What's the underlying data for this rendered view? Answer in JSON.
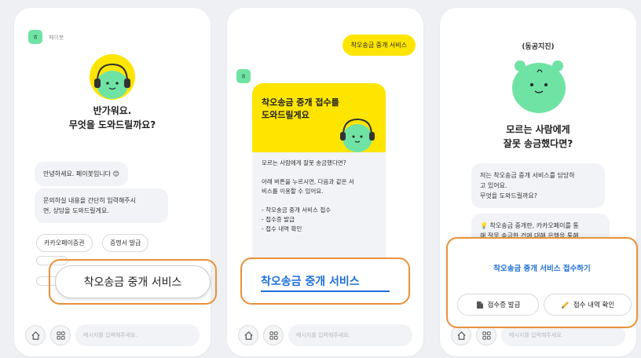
{
  "screen1": {
    "bot_name": "페이봇",
    "greeting_line1": "반가워요.",
    "greeting_line2": "무엇을 도와드릴까요?",
    "bubble_hello": "안녕하세요. 페이봇입니다 😊",
    "bubble_help_line1": "문의하실 내용을 간단히 입력해주시",
    "bubble_help_line2": "면, 상담을 도와드릴게요.",
    "chips": [
      "카카오페이증권",
      "증명서 발급"
    ],
    "highlight_button": "착오송금 중개 서비스",
    "input_placeholder": "메시지를 입력해주세요."
  },
  "screen2": {
    "user_message": "착오송금 중개 서비스",
    "card_title_line1": "착오송금 중개 접수를",
    "card_title_line2": "도와드릴게요",
    "card_lines": [
      "모르는 사람에게 잘못 송금했다면?",
      "",
      "아래 버튼을 누르시면, 다음과 같은 서",
      "비스를 이용할 수 있어요.",
      "",
      "- 착오송금 중개 서비스 접수",
      "- 접수증 발급",
      "- 접수 내역 확인"
    ],
    "highlight_link": "착오송금 중개 서비스",
    "input_placeholder": "메시지를 입력해주세요."
  },
  "screen3": {
    "mascot_caption": "(동공지진)",
    "headline_line1": "모르는 사람에게",
    "headline_line2": "잘못 송금했다면?",
    "bubble_line1": "저는 착오송금 중개 서비스를 담당하",
    "bubble_line2": "고 있어요.",
    "bubble_line3": "무엇을 도와드릴까요?",
    "tip_line1": "💡 착오송금 중개란, 카카오페이를 통",
    "tip_line2": "해 잘못 송금한 건에 대해 은행을 통해",
    "action_primary": "착오송금 중개 서비스 접수하기",
    "action_receipt": "접수증 발급",
    "action_history": "접수 내역 확인",
    "input_placeholder": "메시지를 입력해주세요."
  },
  "colors": {
    "kakao_yellow": "#fee500",
    "mascot_green": "#6fe3a4",
    "highlight_orange": "#e9913a",
    "link_blue": "#1e6fd9",
    "page_bg": "#eef0f3"
  }
}
